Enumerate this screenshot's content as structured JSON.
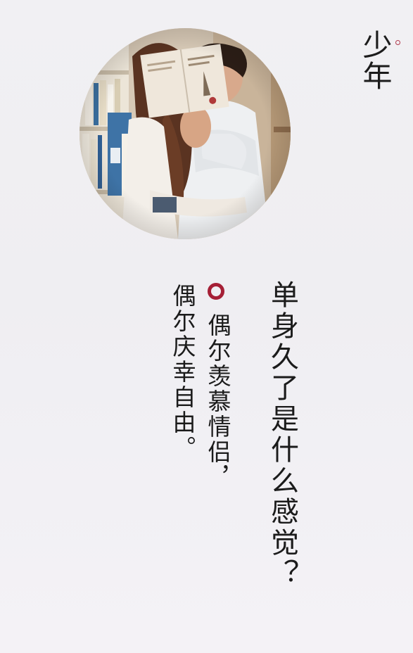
{
  "brand": {
    "title": "少年"
  },
  "poem": {
    "headline": "单身久了是什么感觉？",
    "line1": "偶尔羡慕情侣，",
    "line2": "偶尔庆幸自由。"
  },
  "colors": {
    "background": "#f0eff3",
    "accent_ring": "#a51f36",
    "text": "#1b1b1b"
  },
  "icons": {
    "bullet": "red-ring-bullet-icon",
    "corner": "small-ring-icon"
  }
}
